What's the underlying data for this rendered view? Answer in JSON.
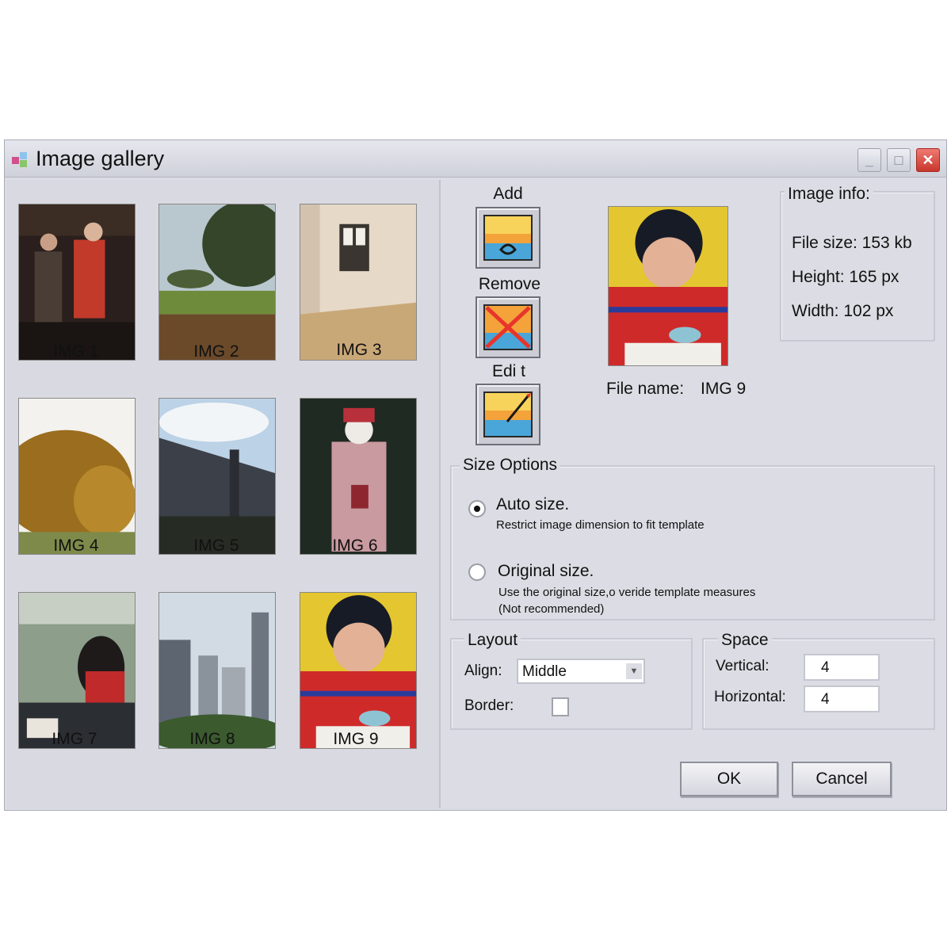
{
  "window": {
    "title": "Image gallery"
  },
  "gallery": {
    "items": [
      {
        "label": "IMG 1"
      },
      {
        "label": "IMG 2"
      },
      {
        "label": "IMG 3"
      },
      {
        "label": "IMG 4"
      },
      {
        "label": "IMG 5"
      },
      {
        "label": "IMG 6"
      },
      {
        "label": "IMG 7"
      },
      {
        "label": "IMG 8"
      },
      {
        "label": "IMG 9"
      }
    ]
  },
  "toolbar": {
    "add_label": "Add",
    "remove_label": "Remove",
    "edit_label": "Edi t"
  },
  "preview": {
    "file_name_label": "File name:",
    "file_name_value": "IMG 9"
  },
  "image_info": {
    "title": "Image info:",
    "file_size": "File size: 153 kb",
    "height": "Height: 165 px",
    "width": "Width: 102 px"
  },
  "size_options": {
    "title": "Size Options",
    "auto": {
      "title": "Auto size.",
      "desc": "Restrict image dimension to fit template",
      "selected": true
    },
    "original": {
      "title": "Original size.",
      "desc1": "Use the original size,o veride template measures",
      "desc2": "(Not recommended)",
      "selected": false
    }
  },
  "layout": {
    "title": "Layout",
    "align_label": "Align:",
    "align_value": "Middle",
    "border_label": "Border:",
    "border_checked": false
  },
  "space": {
    "title": "Space",
    "vertical_label": "Vertical:",
    "vertical_value": "4",
    "horizontal_label": "Horizontal:",
    "horizontal_value": "4"
  },
  "buttons": {
    "ok": "OK",
    "cancel": "Cancel"
  },
  "colors": {
    "window_bg": "#dcdde4",
    "close_button": "#d8453b"
  }
}
